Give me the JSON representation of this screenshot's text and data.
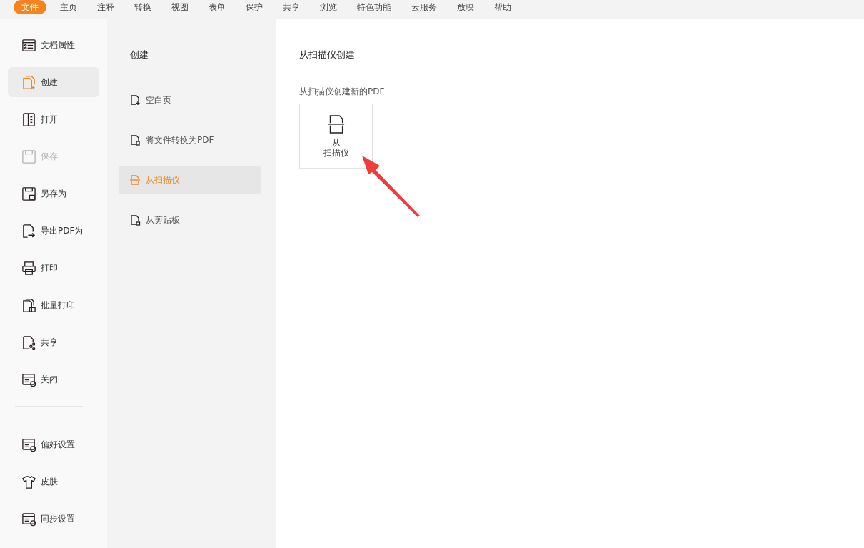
{
  "menu_tabs": [
    {
      "label": "文件",
      "selected": true
    },
    {
      "label": "主页",
      "selected": false
    },
    {
      "label": "注释",
      "selected": false
    },
    {
      "label": "转换",
      "selected": false
    },
    {
      "label": "视图",
      "selected": false
    },
    {
      "label": "表单",
      "selected": false
    },
    {
      "label": "保护",
      "selected": false
    },
    {
      "label": "共享",
      "selected": false
    },
    {
      "label": "浏览",
      "selected": false
    },
    {
      "label": "特色功能",
      "selected": false
    },
    {
      "label": "云服务",
      "selected": false
    },
    {
      "label": "放映",
      "selected": false
    },
    {
      "label": "帮助",
      "selected": false
    }
  ],
  "sidebar": {
    "items": [
      {
        "kind": "properties",
        "label": "文档属性",
        "selected": false,
        "disabled": false
      },
      {
        "kind": "create",
        "label": "创建",
        "selected": true,
        "disabled": false
      },
      {
        "kind": "open",
        "label": "打开",
        "selected": false,
        "disabled": false
      },
      {
        "kind": "save",
        "label": "保存",
        "selected": false,
        "disabled": true
      },
      {
        "kind": "saveas",
        "label": "另存为",
        "selected": false,
        "disabled": false
      },
      {
        "kind": "export",
        "label": "导出PDF为",
        "selected": false,
        "disabled": false
      },
      {
        "kind": "print",
        "label": "打印",
        "selected": false,
        "disabled": false
      },
      {
        "kind": "batchprint",
        "label": "批量打印",
        "selected": false,
        "disabled": false
      },
      {
        "kind": "share",
        "label": "共享",
        "selected": false,
        "disabled": false
      },
      {
        "kind": "close",
        "label": "关闭",
        "selected": false,
        "disabled": false
      }
    ],
    "bottom_items": [
      {
        "kind": "preferences",
        "label": "偏好设置",
        "selected": false,
        "disabled": false
      },
      {
        "kind": "skin",
        "label": "皮肤",
        "selected": false,
        "disabled": false
      },
      {
        "kind": "sync",
        "label": "同步设置",
        "selected": false,
        "disabled": false
      }
    ]
  },
  "create_panel": {
    "heading": "创建",
    "items": [
      {
        "kind": "blank",
        "label": "空白页",
        "selected": false
      },
      {
        "kind": "convert",
        "label": "将文件转换为PDF",
        "selected": false
      },
      {
        "kind": "scanner",
        "label": "从扫描仪",
        "selected": true
      },
      {
        "kind": "clipboard",
        "label": "从剪贴板",
        "selected": false
      }
    ]
  },
  "content": {
    "title": "从扫描仪创建",
    "subtitle": "从扫描仪创建新的PDF",
    "card_label_lines": [
      "从",
      "扫描仪"
    ]
  }
}
